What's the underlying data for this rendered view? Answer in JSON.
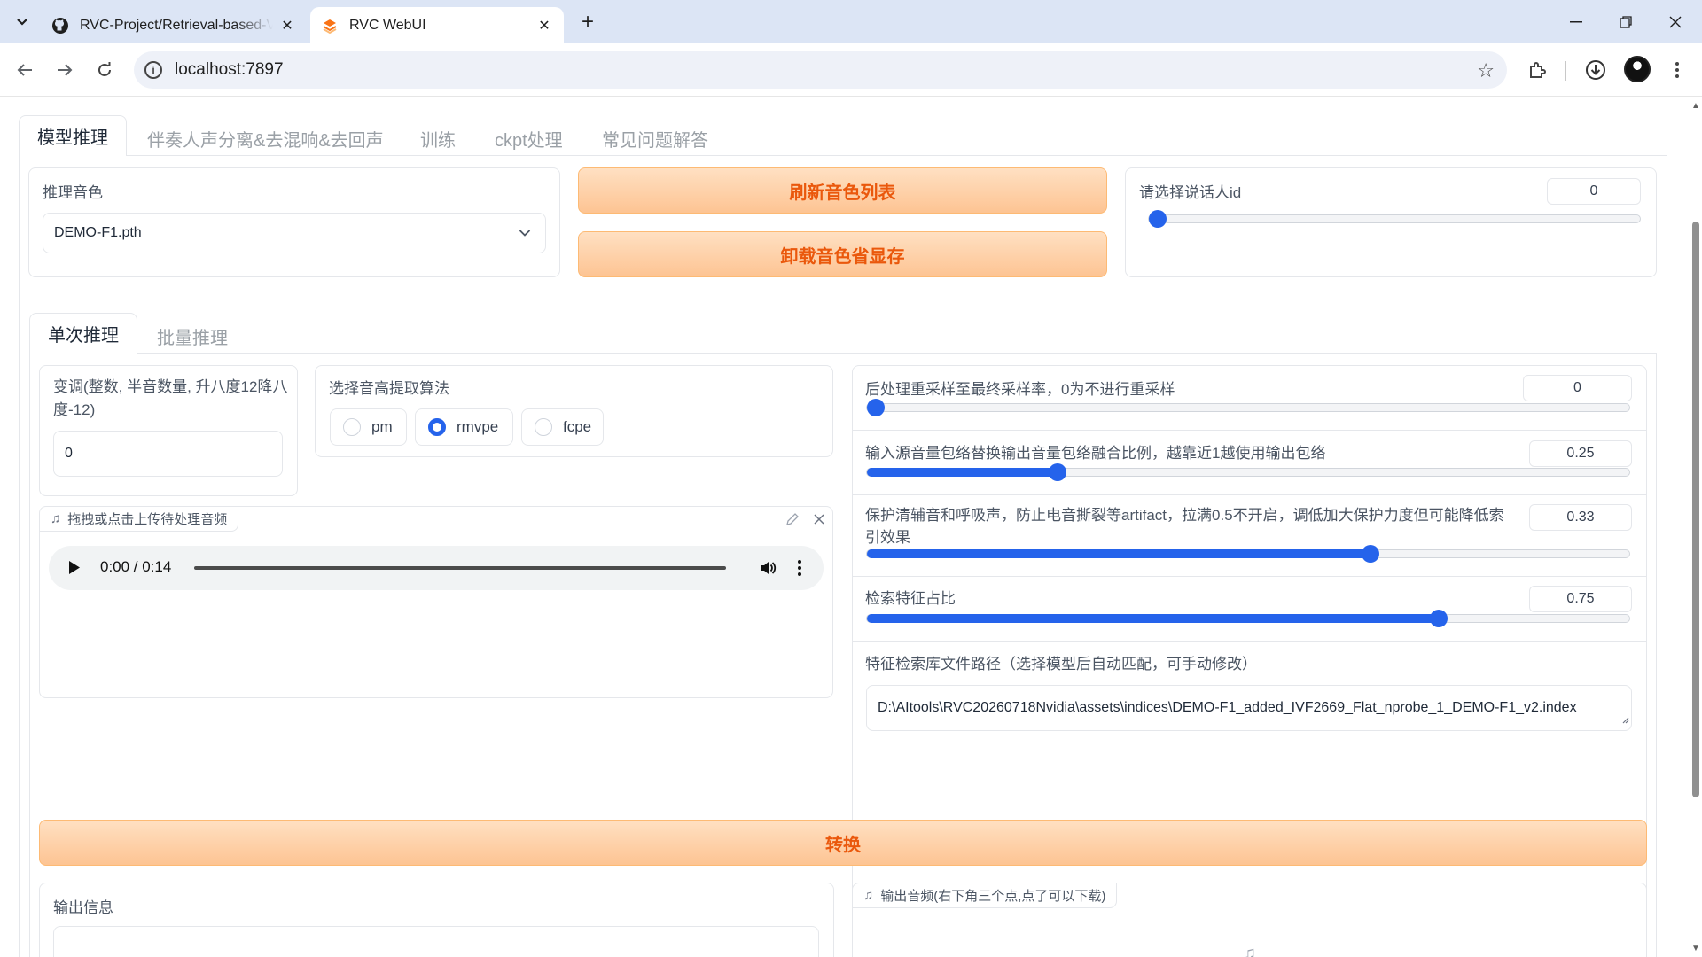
{
  "browser": {
    "tabs": [
      {
        "title": "RVC-Project/Retrieval-based-Voice-Conversion-WebUI",
        "icon": "github-icon",
        "active": false
      },
      {
        "title": "RVC WebUI",
        "icon": "gradio-icon",
        "active": true
      }
    ],
    "url": "localhost:7897"
  },
  "main_tabs": [
    "模型推理",
    "伴奏人声分离&去混响&去回声",
    "训练",
    "ckpt处理",
    "常见问题解答"
  ],
  "model_panel": {
    "voice_label": "推理音色",
    "voice_value": "DEMO-F1.pth",
    "refresh_button": "刷新音色列表",
    "unload_button": "卸载音色省显存",
    "speaker_label": "请选择说话人id",
    "speaker_value": "0",
    "speaker_slider_fraction": 0
  },
  "sub_tabs": [
    "单次推理",
    "批量推理"
  ],
  "single": {
    "transpose_label": "变调(整数, 半音数量, 升八度12降八度-12)",
    "transpose_value": "0",
    "f0_label": "选择音高提取算法",
    "f0_options": [
      "pm",
      "rmvpe",
      "fcpe"
    ],
    "f0_selected": "rmvpe",
    "upload_label": "拖拽或点击上传待处理音频",
    "audio_time": "0:00 / 0:14",
    "resample_label": "后处理重采样至最终采样率，0为不进行重采样",
    "resample_value": "0",
    "rms_label": "输入源音量包络替换输出音量包络融合比例，越靠近1越使用输出包络",
    "rms_value": "0.25",
    "protect_label": "保护清辅音和呼吸声，防止电音撕裂等artifact，拉满0.5不开启，调低加大保护力度但可能降低索引效果",
    "protect_value": "0.33",
    "index_rate_label": "检索特征占比",
    "index_rate_value": "0.75",
    "index_path_label": "特征检索库文件路径（选择模型后自动匹配，可手动修改）",
    "index_path_value": "D:\\AItools\\RVC20260718Nvidia\\assets\\indices\\DEMO-F1_added_IVF2669_Flat_nprobe_1_DEMO-F1_v2.index",
    "convert_button": "转换",
    "output_info_label": "输出信息",
    "output_audio_label": "输出音频(右下角三个点,点了可以下载)"
  },
  "sliders": {
    "speaker": 0,
    "resample": 0,
    "rms": 0.25,
    "protect": 0.66,
    "index_rate": 0.75
  },
  "colors": {
    "accent": "#2563eb",
    "orange_text": "#ea580c",
    "orange_bg": "#fdc493"
  }
}
